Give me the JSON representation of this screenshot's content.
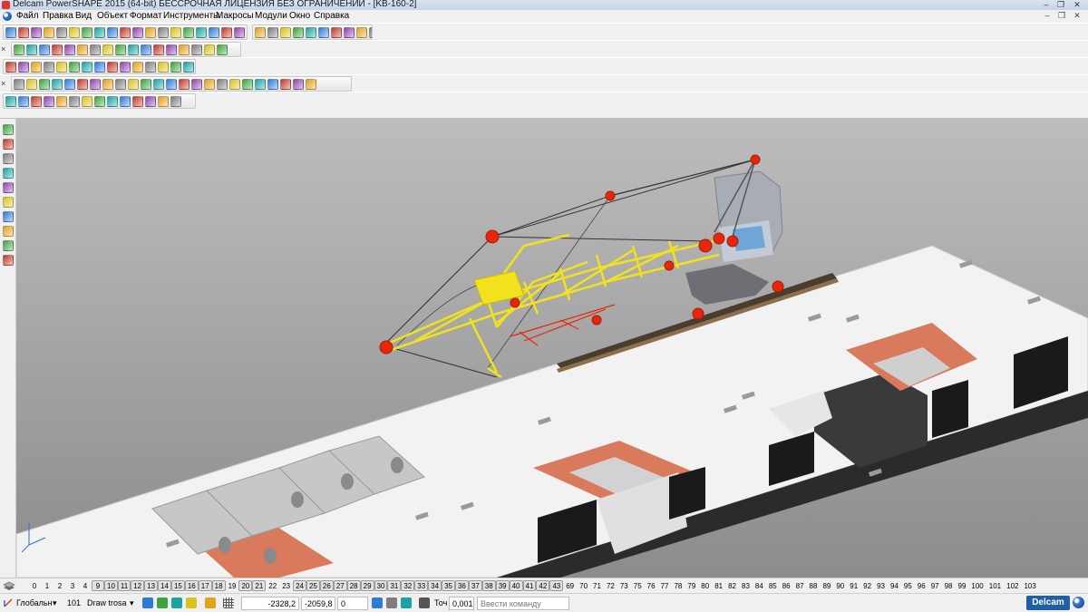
{
  "window": {
    "title": "Delcam PowerSHAPE 2015 (64-bit) БЕССРОЧНАЯ ЛИЦЕНЗИЯ БЕЗ ОГРАНИЧЕНИЙ - [KB-160-2]",
    "controls": {
      "minimize": "–",
      "restore": "❐",
      "close": "✕"
    }
  },
  "menu": {
    "items": [
      "Файл",
      "Правка",
      "Вид",
      "Объект",
      "Формат",
      "Инструменты",
      "Макросы",
      "Модули",
      "Окно",
      "Справка"
    ],
    "mdi_controls": {
      "minimize": "–",
      "restore": "❐",
      "close": "✕"
    }
  },
  "toolbars": {
    "row_grip": "×",
    "icon_colors": [
      "#2f7ad9",
      "#e2a21b",
      "#3da33d",
      "#c0392b",
      "#7d7d7d",
      "#19a3a3",
      "#8e44ad",
      "#d9c21e"
    ]
  },
  "layers": {
    "numbers": [
      "0",
      "1",
      "2",
      "3",
      "4",
      "9",
      "10",
      "11",
      "12",
      "13",
      "14",
      "15",
      "16",
      "17",
      "18",
      "19",
      "20",
      "21",
      "22",
      "23",
      "24",
      "25",
      "26",
      "27",
      "28",
      "29",
      "30",
      "31",
      "32",
      "33",
      "34",
      "35",
      "36",
      "37",
      "38",
      "39",
      "40",
      "41",
      "42",
      "43",
      "69",
      "70",
      "71",
      "72",
      "73",
      "75",
      "76",
      "77",
      "78",
      "79",
      "80",
      "81",
      "82",
      "83",
      "84",
      "85",
      "86",
      "87",
      "88",
      "89",
      "90",
      "91",
      "92",
      "93",
      "94",
      "95",
      "96",
      "97",
      "98",
      "99",
      "100",
      "101",
      "102",
      "103"
    ],
    "boxed": [
      "9",
      "10",
      "11",
      "12",
      "13",
      "14",
      "15",
      "16",
      "17",
      "18",
      "20",
      "21",
      "24",
      "25",
      "26",
      "27",
      "28",
      "29",
      "30",
      "31",
      "32",
      "33",
      "34",
      "35",
      "36",
      "37",
      "38",
      "39",
      "40",
      "41",
      "42",
      "43"
    ]
  },
  "status": {
    "workplane": "Глобальн",
    "level_number": "101",
    "level_name": "Draw trosa",
    "coord_x": "-2328,2",
    "coord_y": "-2059,8",
    "coord_z": "0",
    "tolerance_label": "Точ",
    "tolerance_value": "0,001",
    "command_placeholder": "Ввести команду",
    "brand": "Delcam"
  },
  "colors": {
    "crane_yellow": "#f2e21c",
    "crane_red": "#e8260c",
    "cabin_grey": "#a8adb5",
    "slab_white": "#f2f2f2",
    "opening_orange": "#d97a5c",
    "rail_dark": "#4a3d2e"
  }
}
